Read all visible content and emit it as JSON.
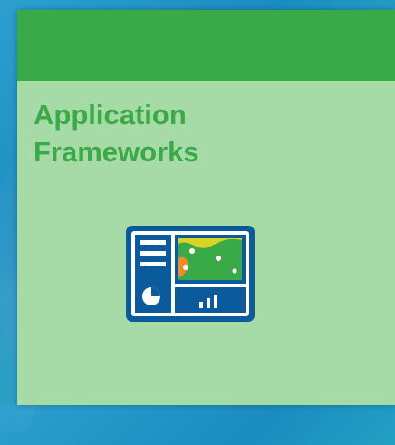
{
  "tile": {
    "title": "Application\nFrameworks",
    "header_color": "#3aa947",
    "body_color": "#a6dba7",
    "icon": "dashboard-app-icon"
  },
  "colors": {
    "icon_blue": "#0b5a9b",
    "icon_map_green": "#3aa947",
    "icon_map_yellow": "#d9d324",
    "icon_map_orange": "#f28c28"
  }
}
